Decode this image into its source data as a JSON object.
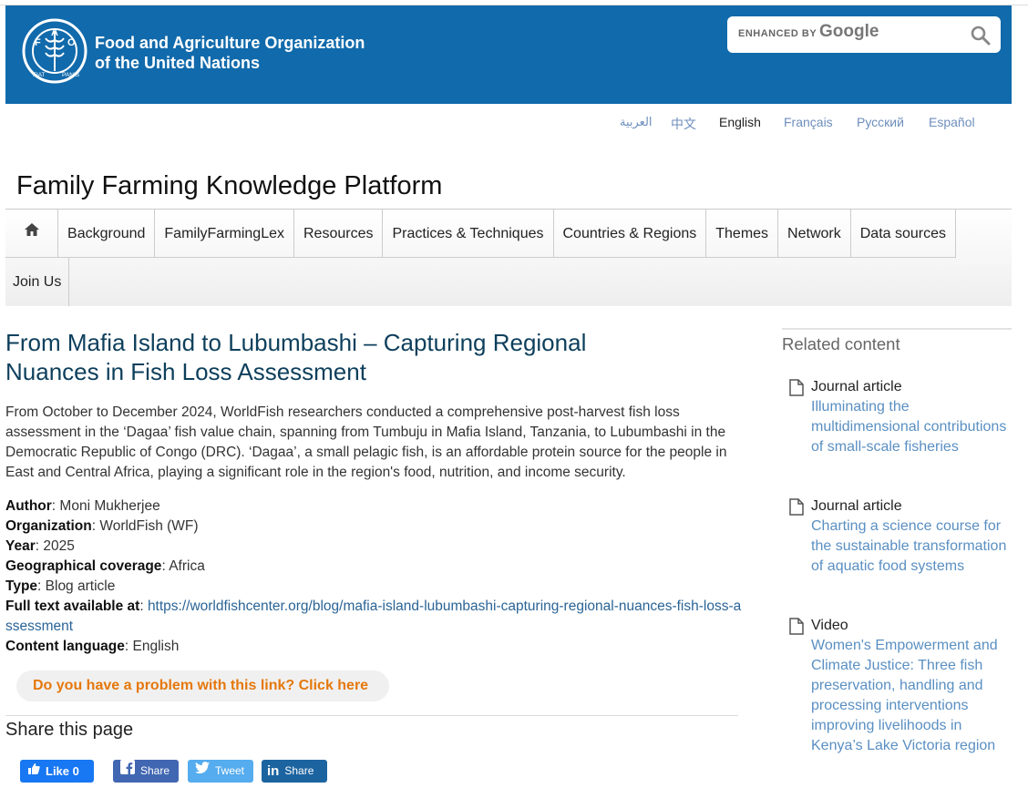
{
  "header": {
    "org_line1": "Food and Agriculture Organization",
    "org_line2": "of the United Nations",
    "logo_text": "FAO",
    "logo_motto": "FIAT PANIS",
    "search_enhanced": "ENHANCED BY",
    "search_brand": "Google",
    "brand_color": "#116aab"
  },
  "languages": [
    {
      "label": "العربية"
    },
    {
      "label": "中文"
    },
    {
      "label": "English",
      "active": true
    },
    {
      "label": "Français"
    },
    {
      "label": "Русский"
    },
    {
      "label": "Español"
    }
  ],
  "platform_title": "Family Farming Knowledge Platform",
  "nav": {
    "home_icon": "home-icon",
    "items": [
      "Background",
      "FamilyFarmingLex",
      "Resources",
      "Practices & Techniques",
      "Countries & Regions",
      "Themes",
      "Network",
      "Data sources",
      "Join Us"
    ]
  },
  "article": {
    "title": "From Mafia Island to Lubumbashi – Capturing Regional Nuances in Fish Loss Assessment",
    "lead": "From October to December 2024, WorldFish researchers conducted a comprehensive post-harvest fish loss assessment in the ‘Dagaa’ fish value chain, spanning from Tumbuju in Mafia Island, Tanzania, to Lubumbashi in the Democratic Republic of Congo (DRC). ‘Dagaa’, a small pelagic fish, is an affordable protein source for the people in East and Central Africa, playing a significant role in the region's food, nutrition, and income security.",
    "meta": {
      "author_label": "Author",
      "author": "Moni Mukherjee",
      "org_label": "Organization",
      "org": "WorldFish (WF)",
      "year_label": "Year",
      "year": "2025",
      "geo_label": "Geographical coverage",
      "geo": "Africa",
      "type_label": "Type",
      "type": "Blog article",
      "fulltext_label": "Full text available at",
      "fulltext": "https://worldfishcenter.org/blog/mafia-island-lubumbashi-capturing-regional-nuances-fish-loss-assessment",
      "lang_label": "Content language",
      "lang": "English"
    },
    "problem_link": "Do you have a problem with this link? Click here",
    "share_title": "Share this page",
    "share": {
      "fb_like": "Like 0",
      "fb_share": "Share",
      "tweet": "Tweet",
      "li_share": "Share"
    }
  },
  "sidebar": {
    "heading": "Related content",
    "items": [
      {
        "type": "Journal article",
        "title": "Illuminating the multidimensional contributions of small-scale fisheries"
      },
      {
        "type": "Journal article",
        "title": "Charting a science course for the sustainable transformation of aquatic food systems"
      },
      {
        "type": "Video",
        "title": "Women's Empowerment and Climate Justice: Three fish preservation, handling and processing interventions improving livelihoods in Kenya’s Lake Victoria region"
      }
    ]
  }
}
